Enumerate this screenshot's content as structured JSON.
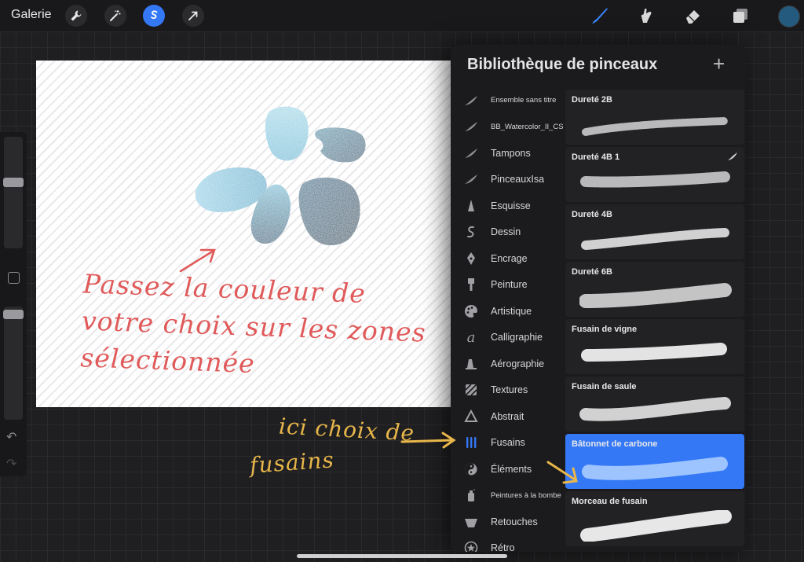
{
  "topbar": {
    "gallery_label": "Galerie",
    "color_well": "#235a7e"
  },
  "icons": {
    "actions": "wrench-icon",
    "adjustments": "magic-wand-icon",
    "selection": "selection-s-icon",
    "transform": "arrow-cursor-icon",
    "paint": "brush-icon",
    "smudge": "smudge-finger-icon",
    "eraser": "eraser-icon",
    "layers": "layers-icon"
  },
  "panel": {
    "title": "Bibliothèque de pinceaux",
    "add_symbol": "+"
  },
  "brush_sets": [
    {
      "label": "Ensemble sans titre",
      "icon": "feather-icon",
      "small": true
    },
    {
      "label": "BB_Watercolor_II_CS",
      "icon": "feather-icon",
      "small": true
    },
    {
      "label": "Tampons",
      "icon": "feather-icon"
    },
    {
      "label": "PinceauxIsa",
      "icon": "feather-icon"
    },
    {
      "label": "Esquisse",
      "icon": "pencil-tip-icon"
    },
    {
      "label": "Dessin",
      "icon": "squiggle-icon"
    },
    {
      "label": "Encrage",
      "icon": "pen-nib-icon"
    },
    {
      "label": "Peinture",
      "icon": "paintbrush-icon"
    },
    {
      "label": "Artistique",
      "icon": "palette-icon"
    },
    {
      "label": "Calligraphie",
      "icon": "calligraphy-a-icon"
    },
    {
      "label": "Aérographie",
      "icon": "airbrush-icon"
    },
    {
      "label": "Textures",
      "icon": "texture-icon"
    },
    {
      "label": "Abstrait",
      "icon": "triangle-icon"
    },
    {
      "label": "Fusains",
      "icon": "charcoal-bars-icon",
      "active": true
    },
    {
      "label": "Éléments",
      "icon": "yin-yang-icon"
    },
    {
      "label": "Peintures à la bombe",
      "icon": "spray-can-icon",
      "small": true
    },
    {
      "label": "Retouches",
      "icon": "bowl-icon"
    },
    {
      "label": "Rétro",
      "icon": "star-badge-icon"
    }
  ],
  "brushes": [
    {
      "name": "Dureté 2B"
    },
    {
      "name": "Dureté 4B 1",
      "imported": true
    },
    {
      "name": "Dureté 4B"
    },
    {
      "name": "Dureté 6B"
    },
    {
      "name": "Fusain de vigne"
    },
    {
      "name": "Fusain de saule"
    },
    {
      "name": "Bâtonnet de carbone",
      "selected": true
    },
    {
      "name": "Morceau de fusain"
    }
  ],
  "annotations": {
    "red_line1": "Passez la couleur de",
    "red_line2": "votre choix sur les zones",
    "red_line3": "sélectionnée",
    "yellow_line1": "ici choix de",
    "yellow_line2": "fusains"
  },
  "colors": {
    "accent": "#3478f6",
    "annotation_red": "#e05a5a",
    "annotation_yellow": "#e8b64a"
  }
}
